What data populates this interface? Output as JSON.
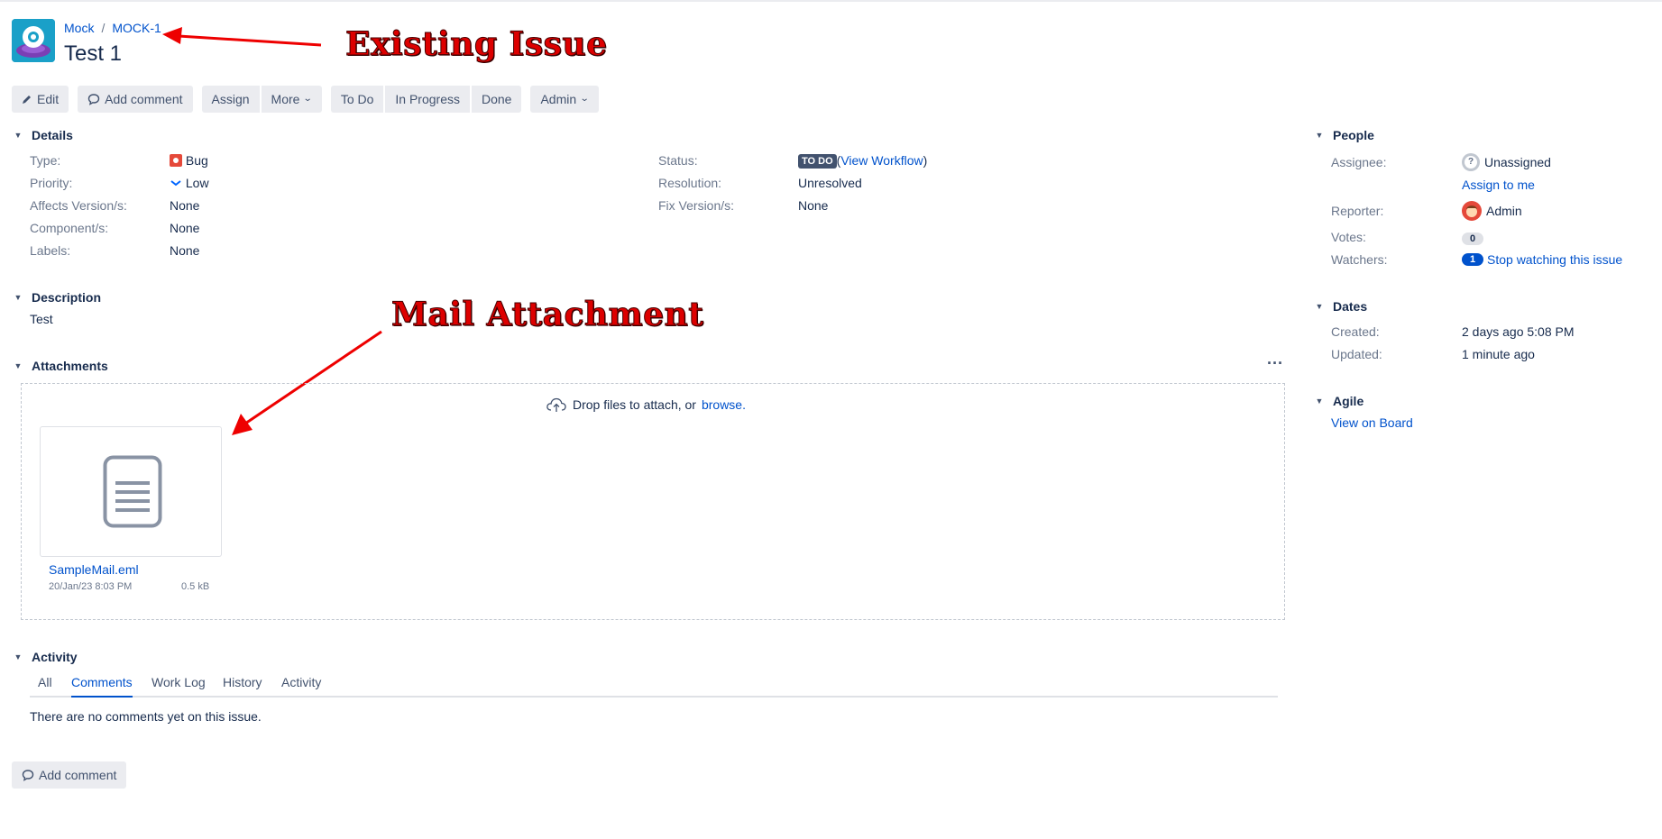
{
  "breadcrumb": {
    "project": "Mock",
    "issue_key": "MOCK-1"
  },
  "issue": {
    "title": "Test 1"
  },
  "annotations": {
    "existing_issue": "Existing Issue",
    "mail_attachment": "Mail Attachment"
  },
  "toolbar": {
    "edit": "Edit",
    "add_comment": "Add comment",
    "assign": "Assign",
    "more": "More",
    "todo": "To Do",
    "in_progress": "In Progress",
    "done": "Done",
    "admin": "Admin"
  },
  "details": {
    "heading": "Details",
    "type_label": "Type:",
    "type_value": "Bug",
    "priority_label": "Priority:",
    "priority_value": "Low",
    "affects_label": "Affects Version/s:",
    "affects_value": "None",
    "component_label": "Component/s:",
    "component_value": "None",
    "labels_label": "Labels:",
    "labels_value": "None",
    "status_label": "Status:",
    "status_value": "TO DO",
    "view_workflow": "View Workflow",
    "resolution_label": "Resolution:",
    "resolution_value": "Unresolved",
    "fix_label": "Fix Version/s:",
    "fix_value": "None"
  },
  "description": {
    "heading": "Description",
    "text": "Test"
  },
  "attachments": {
    "heading": "Attachments",
    "drop_text": "Drop files to attach, or",
    "browse": "browse.",
    "file": {
      "name": "SampleMail.eml",
      "date": "20/Jan/23 8:03 PM",
      "size": "0.5 kB"
    }
  },
  "activity": {
    "heading": "Activity",
    "tabs": [
      "All",
      "Comments",
      "Work Log",
      "History",
      "Activity"
    ],
    "active_tab": "Comments",
    "empty": "There are no comments yet on this issue.",
    "add_comment": "Add comment"
  },
  "people": {
    "heading": "People",
    "assignee_label": "Assignee:",
    "assignee_value": "Unassigned",
    "assign_to_me": "Assign to me",
    "reporter_label": "Reporter:",
    "reporter_value": "Admin",
    "votes_label": "Votes:",
    "votes_value": "0",
    "watchers_label": "Watchers:",
    "watchers_count": "1",
    "stop_watching": "Stop watching this issue"
  },
  "dates": {
    "heading": "Dates",
    "created_label": "Created:",
    "created_value": "2 days ago 5:08 PM",
    "updated_label": "Updated:",
    "updated_value": "1 minute ago"
  },
  "agile": {
    "heading": "Agile",
    "view_on_board": "View on Board"
  },
  "colors": {
    "link": "#0052cc",
    "annotation": "#dd0000",
    "bug": "#e5493a",
    "lozenge": "#42526e"
  }
}
